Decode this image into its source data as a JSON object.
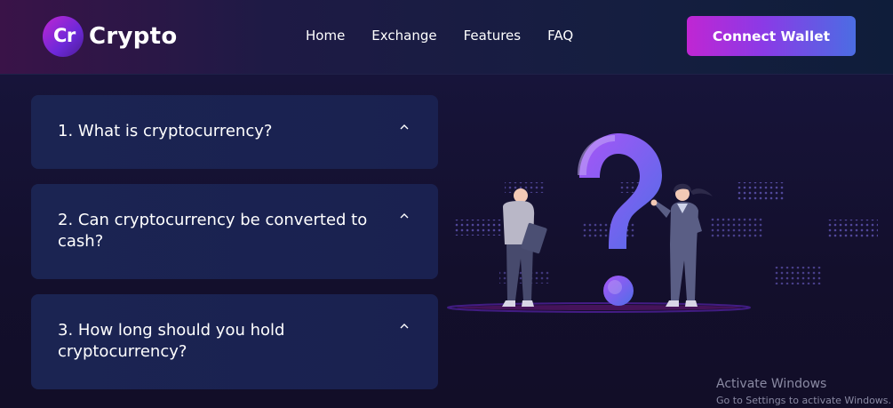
{
  "brand": {
    "mark": "Cr",
    "name": "Crypto"
  },
  "nav": {
    "items": [
      "Home",
      "Exchange",
      "Features",
      "FAQ"
    ]
  },
  "header": {
    "cta_label": "Connect Wallet"
  },
  "faq": {
    "items": [
      {
        "question": "1. What is cryptocurrency?",
        "expanded": true
      },
      {
        "question": "2. Can cryptocurrency be converted to cash?",
        "expanded": true
      },
      {
        "question": "3. How long should you hold cryptocurrency?",
        "expanded": true
      }
    ]
  },
  "colors": {
    "accent_purple": "#c026d3",
    "accent_blue": "#4b6de3",
    "card_bg": "#1b2452",
    "page_bg": "#120f2b"
  },
  "os_overlay": {
    "title": "Activate Windows",
    "subtitle": "Go to Settings to activate Windows."
  }
}
